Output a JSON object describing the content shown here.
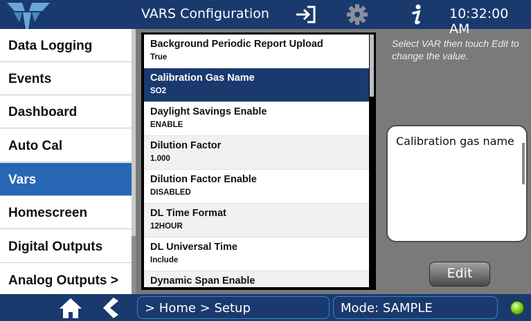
{
  "header": {
    "title": "VARS Configuration",
    "clock": "10:32:00 AM"
  },
  "sidebar": {
    "items": [
      {
        "label": "Data Logging"
      },
      {
        "label": "Events"
      },
      {
        "label": "Dashboard"
      },
      {
        "label": "Auto Cal"
      },
      {
        "label": "Vars",
        "active": true
      },
      {
        "label": "Homescreen"
      },
      {
        "label": "Digital Outputs"
      },
      {
        "label": "Analog Outputs >"
      }
    ]
  },
  "vars": {
    "rows": [
      {
        "name": "Background Periodic Report Upload",
        "value": "True"
      },
      {
        "name": "Calibration Gas Name",
        "value": "SO2",
        "selected": true
      },
      {
        "name": "Daylight Savings Enable",
        "value": "ENABLE"
      },
      {
        "name": "Dilution Factor",
        "value": "1.000"
      },
      {
        "name": "Dilution Factor Enable",
        "value": "DISABLED"
      },
      {
        "name": "DL Time Format",
        "value": "12HOUR"
      },
      {
        "name": "DL Universal Time",
        "value": "Include"
      },
      {
        "name": "Dynamic Span Enable",
        "value": ""
      }
    ]
  },
  "panel": {
    "hint": "Select VAR then touch Edit to change the value.",
    "description": "Calibration gas name",
    "edit_label": "Edit"
  },
  "footer": {
    "breadcrumb": "> Home > Setup",
    "mode": "Mode: SAMPLE"
  },
  "colors": {
    "bar_background": "#1a3a6e",
    "active_sidebar": "#2767b3",
    "selected_row": "#1a3a6e",
    "status_led": "#7fd21e"
  }
}
